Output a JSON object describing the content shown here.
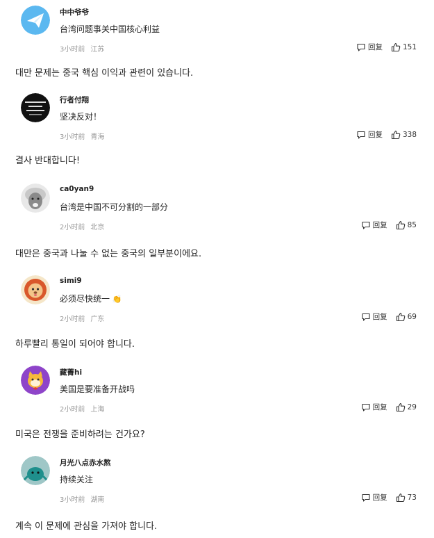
{
  "comments": [
    {
      "username": "中中爷爷",
      "text": "台湾问题事关中国核心利益",
      "time": "3小时前",
      "location": "江苏",
      "reply_label": "回复",
      "likes": "151",
      "avatar_icon": "paper-plane-icon",
      "translation": "대만 문제는 중국 핵심 이익과 관련이 있습니다."
    },
    {
      "username": "行者付翔",
      "text": "坚决反对！",
      "time": "3小时前",
      "location": "青海",
      "reply_label": "回复",
      "likes": "338",
      "avatar_icon": "text-image-icon",
      "translation": "결사 반대합니다!"
    },
    {
      "username": "ca0yan9",
      "text": "台湾是中国不可分割的一部分",
      "time": "2小时前",
      "location": "北京",
      "reply_label": "回复",
      "likes": "85",
      "avatar_icon": "portrait-photo-icon",
      "translation": "대만은 중국과 나눌 수 없는 중국의 일부분이에요."
    },
    {
      "username": "simi9",
      "text": "必须尽快统一",
      "emoji": "👏",
      "time": "2小时前",
      "location": "广东",
      "reply_label": "回复",
      "likes": "69",
      "avatar_icon": "lion-cartoon-icon",
      "translation": "하루빨리 통일이 되어야 합니다."
    },
    {
      "username": "藏菁hi",
      "text": "美国是要准备开战吗",
      "time": "2小时前",
      "location": "上海",
      "reply_label": "回复",
      "likes": "29",
      "avatar_icon": "cat-cartoon-icon",
      "translation": "미국은 전쟁을 준비하려는 건가요?"
    },
    {
      "username": "月光八点赤水熬",
      "text": "持续关注",
      "time": "3小时前",
      "location": "湖南",
      "reply_label": "回复",
      "likes": "73",
      "avatar_icon": "teal-creature-icon",
      "translation": "계속 이 문제에 관심을 가져야 합니다."
    }
  ],
  "colors": {
    "text": "#222222",
    "meta": "#999999",
    "action": "#333333"
  }
}
